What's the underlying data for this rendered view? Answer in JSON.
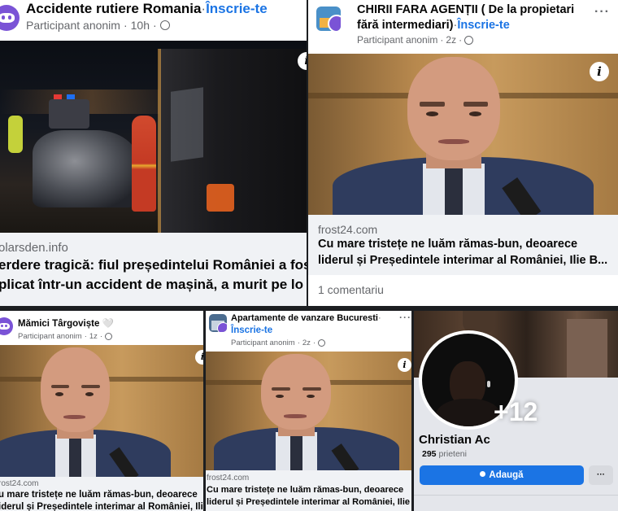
{
  "panel1": {
    "group_name": "Accidente rutiere Romania",
    "separator": " · ",
    "join_label": "Înscrie-te",
    "author": "Participant anonim",
    "time": "10h",
    "link_domain": "olarsden.info",
    "headline_line1": "erdere tragică: fiul președintelui României a fos",
    "headline_line2": "plicat într-un accident de mașină, a murit pe lo"
  },
  "panel2": {
    "group_name_line1": "CHIRII FARA AGENȚII ( De la propietari",
    "group_name_line2": "fără intermediari)",
    "separator": " · ",
    "join_label": "Înscrie-te",
    "author": "Participant anonim",
    "time": "2z",
    "more_label": "···",
    "info_label": "i",
    "link_domain": "frost24.com",
    "headline_line1": "Cu mare tristețe ne luăm rămas-bun, deoarece",
    "headline_line2": "liderul și Președintele interimar al României, Ilie B...",
    "comments": "1 comentariu"
  },
  "panel3": {
    "group_name": "Mămici Târgoviște 🤍",
    "author": "Participant anonim",
    "time": "1z",
    "link_domain": "rost24.com",
    "headline_line1": "u mare tristețe ne luăm rămas-bun, deoarece",
    "headline_line2": "iderul și Președintele interimar al României, Ilie B..."
  },
  "panel4": {
    "group_name": "Apartamente de vanzare Bucuresti",
    "separator": " ·",
    "join_label": "Înscrie-te",
    "author": "Participant anonim",
    "time": "2z",
    "more_label": "···",
    "info_label": "i",
    "link_domain": "frost24.com",
    "headline_line1": "Cu mare tristețe ne luăm rămas-bun, deoarece",
    "headline_line2": "liderul și Președintele interimar al României, Ilie B..."
  },
  "panel5": {
    "overlay_count": "+12",
    "profile_name": "Christian Ac",
    "friends_count": "295",
    "friends_label": "prieteni",
    "add_label": "Adaugă",
    "more_label": "···"
  },
  "colors": {
    "accent": "#1b74e4",
    "group_avatar": "#7a53d6",
    "text": "#050505",
    "muted": "#65676b"
  }
}
